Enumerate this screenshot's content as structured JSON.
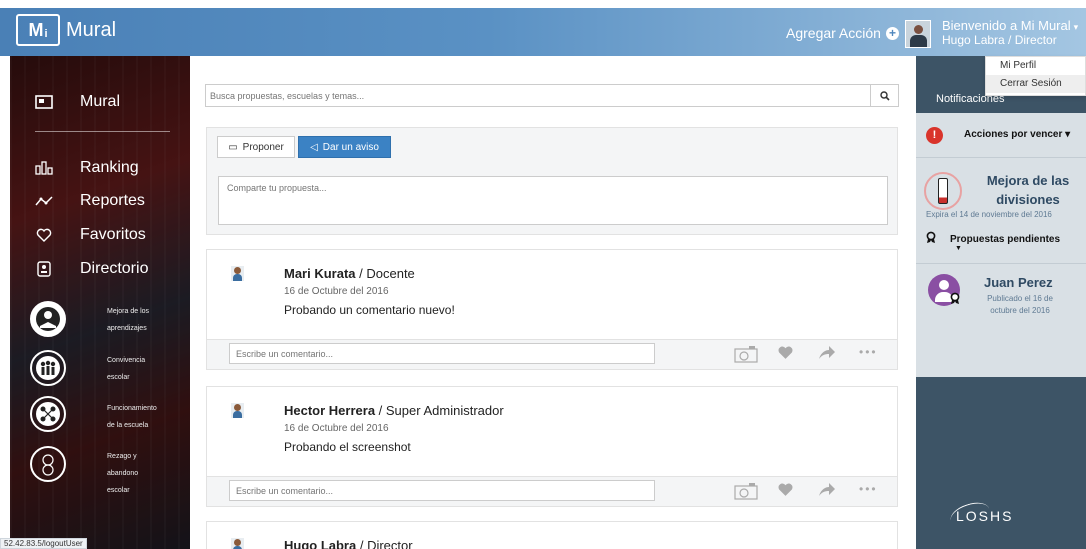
{
  "header": {
    "logo_mark": "M",
    "logo_sub": "i",
    "logo_text": "Mural",
    "add_action": "Agregar Acción",
    "welcome": "Bienvenido a Mi Mural",
    "user_role": "Hugo Labra / Director"
  },
  "user_menu": {
    "items": [
      "Mi Perfil",
      "Cerrar Sesión"
    ]
  },
  "sidebar": {
    "items": [
      {
        "label": "Mural",
        "icon": "board-icon"
      },
      {
        "label": "Ranking",
        "icon": "bar-chart-icon"
      },
      {
        "label": "Reportes",
        "icon": "line-chart-icon"
      },
      {
        "label": "Favoritos",
        "icon": "heart-icon"
      },
      {
        "label": "Directorio",
        "icon": "contact-book-icon"
      }
    ],
    "topics": [
      {
        "line1": "Mejora de los",
        "line2": "aprendizajes"
      },
      {
        "line1": "Convivencia",
        "line2": "escolar"
      },
      {
        "line1": "Funcionamiento",
        "line2": "de la escuela"
      },
      {
        "line1": "Rezago y",
        "line2": "abandono",
        "line3": "escolar"
      }
    ]
  },
  "search": {
    "placeholder": "Busca propuestas, escuelas y temas..."
  },
  "compose": {
    "propose_label": "Proponer",
    "notice_label": "Dar un aviso",
    "placeholder": "Comparte tu propuesta..."
  },
  "posts": [
    {
      "name": "Mari Kurata",
      "role": " / Docente",
      "date": "16 de Octubre del 2016",
      "text": "Probando un comentario nuevo!",
      "comment_placeholder": "Escribe un comentario..."
    },
    {
      "name": "Hector Herrera",
      "role": " / Super Administrador",
      "date": "16 de Octubre del 2016",
      "text": "Probando el screenshot",
      "comment_placeholder": "Escribe un comentario..."
    },
    {
      "name": "Hugo Labra",
      "role": " / Director",
      "date": "",
      "text": "",
      "comment_placeholder": ""
    }
  ],
  "notifications": {
    "title": "Notificaciones",
    "due_actions": "Acciones por vencer",
    "goal_title": "Mejora de las divisiones",
    "goal_expiry": "Expira el 14 de noviembre del 2016",
    "pending": "Propuestas pendientes",
    "user_name": "Juan Perez",
    "user_published": "Publicado el 16 de octubre del 2016",
    "brand": "LOSHS"
  },
  "statusbar": {
    "url": "52.42.83.5/logoutUser"
  },
  "colors": {
    "header_start": "#4a80b6",
    "primary_button": "#3b82c4",
    "alert": "#d9342b",
    "panel_dark": "#3d5466",
    "panel_light": "#d9e0e5"
  }
}
